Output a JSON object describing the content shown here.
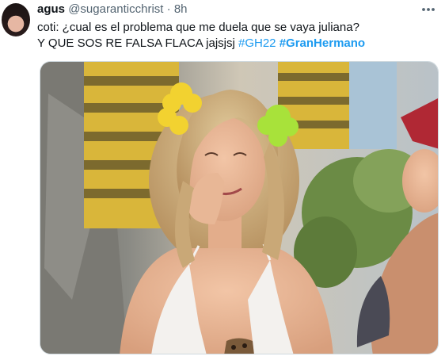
{
  "tweet": {
    "author": {
      "display_name": "agus",
      "handle": "@sugaranticchrist",
      "separator": "·",
      "time": "8h"
    },
    "text_lines": [
      "coti: ¿cual es el problema que me duela que se vaya juliana?",
      "Y QUE SOS RE FALSA FLACA jajsjsj"
    ],
    "hashtags": [
      "#GH22",
      "#GranHermano"
    ],
    "more_icon": "more-dots-icon",
    "colors": {
      "link": "#1d9bf0",
      "secondary_text": "#536471",
      "primary_text": "#0f1419"
    }
  }
}
